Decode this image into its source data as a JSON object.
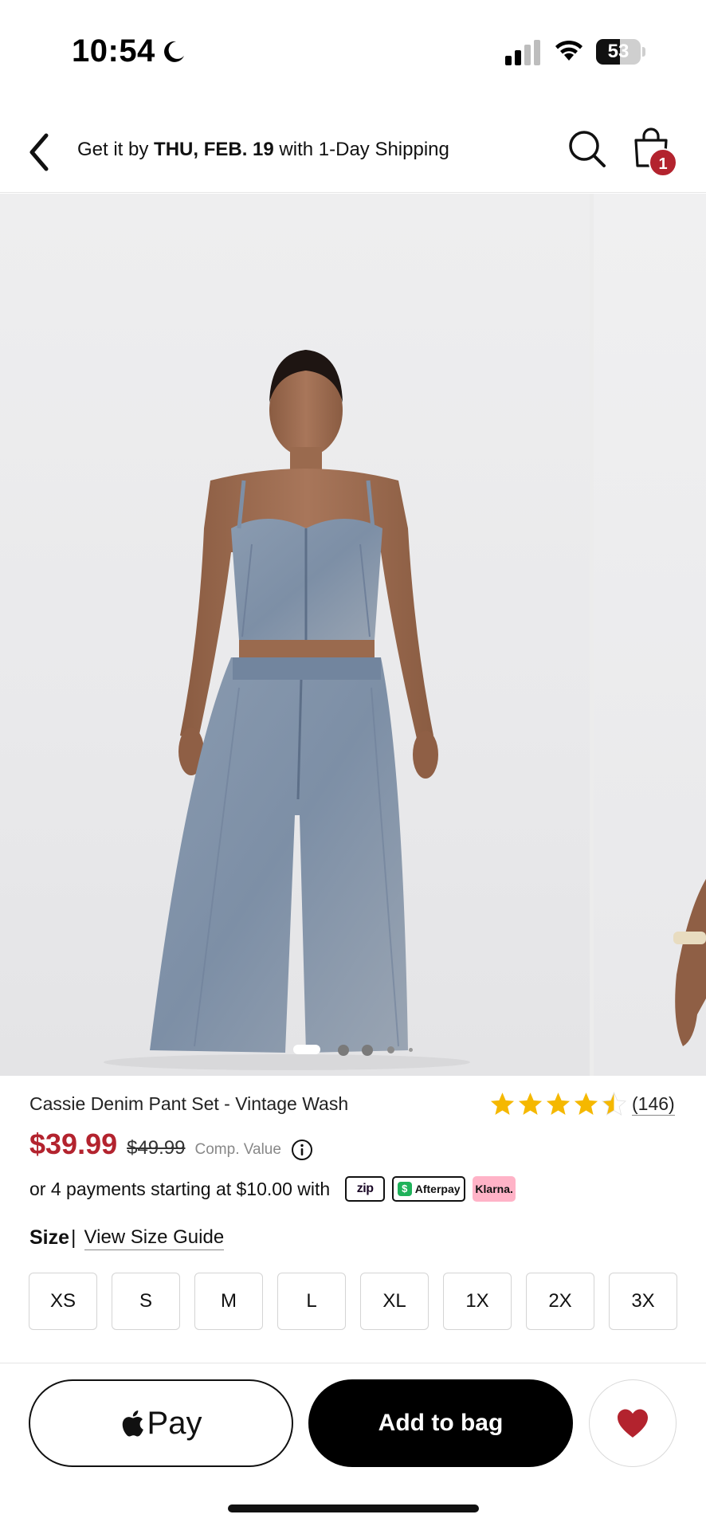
{
  "status_bar": {
    "time": "10:54",
    "battery_level": "53",
    "battery_fraction": 0.53
  },
  "header": {
    "shipping_prefix": "Get it by ",
    "shipping_date": "THU, FEB. 19",
    "shipping_suffix": " with 1-Day Shipping",
    "cart_count": "1"
  },
  "gallery": {
    "image_count": 5,
    "active_index": 0
  },
  "product": {
    "title": "Cassie Denim Pant Set - Vintage Wash",
    "rating": 4.5,
    "review_count": "(146)",
    "price": "$39.99",
    "compare_price": "$49.99",
    "compare_label": "Comp. Value",
    "payments_text": "or 4 payments starting at $10.00 with",
    "payment_providers": [
      "zip",
      "Afterpay",
      "Klarna."
    ],
    "size_label": "Size",
    "size_separator": "|",
    "size_guide_link": "View Size Guide",
    "sizes": [
      "XS",
      "S",
      "M",
      "L",
      "XL",
      "1X",
      "2X",
      "3X"
    ]
  },
  "actions": {
    "apple_pay_label": "Pay",
    "add_to_bag_label": "Add to bag"
  },
  "colors": {
    "sale_red": "#b3232e",
    "star_gold": "#f5b800",
    "denim": "#7f93ab",
    "skin": "#9a6a4e"
  },
  "icons": {
    "status": [
      "moon-icon",
      "signal-icon",
      "wifi-icon",
      "battery-icon"
    ],
    "header": [
      "back-icon",
      "search-icon",
      "shopping-bag-icon"
    ],
    "other": [
      "star-icon",
      "info-icon",
      "apple-logo-icon",
      "heart-icon"
    ]
  }
}
